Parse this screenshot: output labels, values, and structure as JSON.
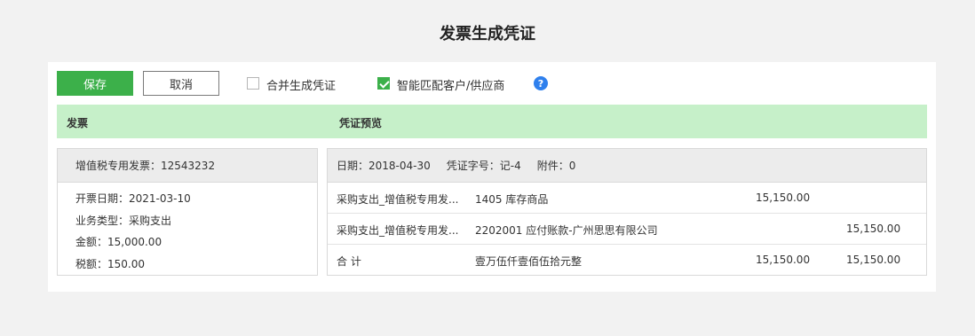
{
  "title": "发票生成凭证",
  "toolbar": {
    "save_label": "保存",
    "cancel_label": "取消",
    "merge_label": "合并生成凭证",
    "merge_checked": false,
    "smart_match_label": "智能匹配客户/供应商",
    "smart_match_checked": true,
    "help_icon": "?"
  },
  "header": {
    "invoice_label": "发票",
    "preview_label": "凭证预览"
  },
  "invoice": {
    "title": "增值税专用发票：12543232",
    "lines": [
      "开票日期：2021-03-10",
      "业务类型：采购支出",
      "金额：15,000.00",
      "税额：150.00"
    ]
  },
  "voucher": {
    "date": "日期：2018-04-30",
    "number": "凭证字号：记-4",
    "attachments": "附件：0",
    "rows": [
      {
        "summary": "采购支出_增值税专用发...",
        "account": "1405 库存商品",
        "debit": "15,150.00",
        "credit": ""
      },
      {
        "summary": "采购支出_增值税专用发...",
        "account": "2202001 应付账款-广州思思有限公司",
        "debit": "",
        "credit": "15,150.00"
      },
      {
        "summary": "合  计",
        "account": "壹万伍仟壹佰伍拾元整",
        "debit": "15,150.00",
        "credit": "15,150.00"
      }
    ]
  },
  "colors": {
    "accent": "#3cb04a",
    "header_bg": "#c6f0c9",
    "help": "#2f80ed"
  }
}
